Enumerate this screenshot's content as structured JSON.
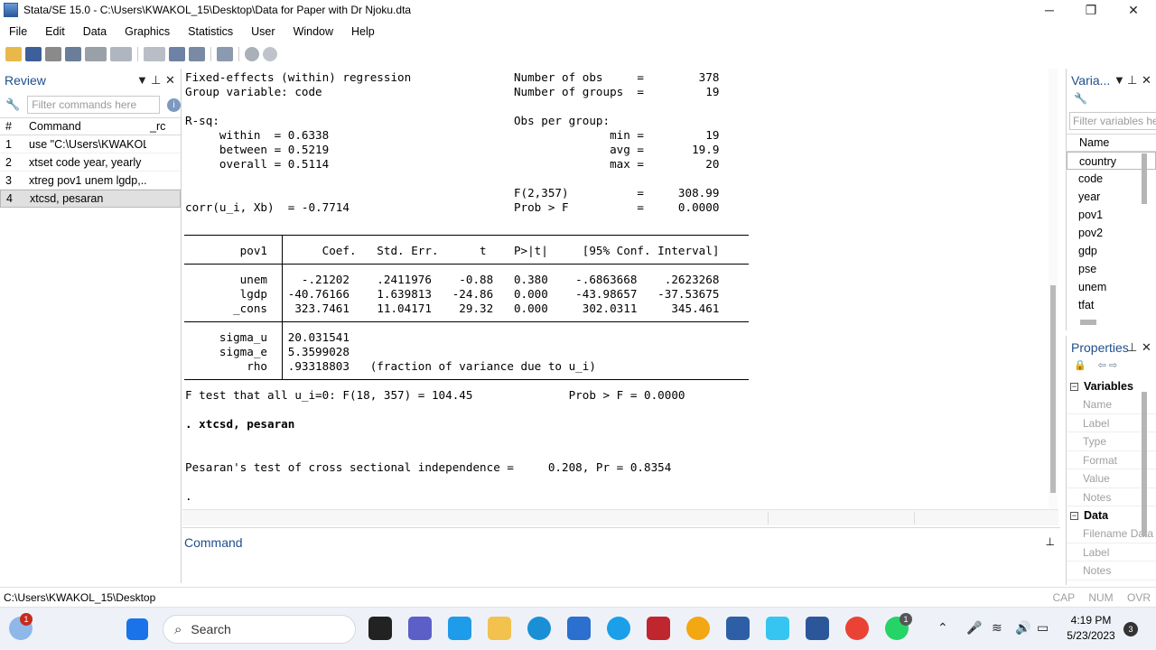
{
  "window": {
    "title": "Stata/SE 15.0 - C:\\Users\\KWAKOL_15\\Desktop\\Data for Paper with Dr Njoku.dta",
    "minimize": "─",
    "restore": "❐",
    "close": "✕"
  },
  "menu": [
    "File",
    "Edit",
    "Data",
    "Graphics",
    "Statistics",
    "User",
    "Window",
    "Help"
  ],
  "review": {
    "title": "Review",
    "filter_placeholder": "Filter commands here",
    "columns": {
      "num": "#",
      "command": "Command",
      "rc": "_rc"
    },
    "rows": [
      {
        "num": "1",
        "command": "use \"C:\\Users\\KWAKOL..."
      },
      {
        "num": "2",
        "command": "xtset code year, yearly"
      },
      {
        "num": "3",
        "command": "xtreg pov1 unem lgdp,..."
      },
      {
        "num": "4",
        "command": "xtcsd, pesaran"
      }
    ]
  },
  "results": {
    "lines": [
      "Fixed-effects (within) regression               Number of obs     =        378",
      "Group variable: code                            Number of groups  =         19",
      "",
      "R-sq:                                           Obs per group:",
      "     within  = 0.6338                                         min =         19",
      "     between = 0.5219                                         avg =       19.9",
      "     overall = 0.5114                                         max =         20",
      "",
      "                                                F(2,357)          =     308.99",
      "corr(u_i, Xb)  = -0.7714                        Prob > F          =     0.0000",
      "",
      "",
      "        pov1        Coef.   Std. Err.      t    P>|t|     [95% Conf. Interval]",
      "",
      "        unem     -.21202    .2411976    -0.88   0.380    -.6863668    .2623268",
      "        lgdp   -40.76166    1.639813   -24.86   0.000    -43.98657   -37.53675",
      "       _cons    323.7461    11.04171    29.32   0.000     302.0311     345.461",
      "",
      "     sigma_u   20.031541",
      "     sigma_e   5.3599028",
      "         rho   .93318803   (fraction of variance due to u_i)",
      "",
      "F test that all u_i=0: F(18, 357) = 104.45              Prob > F = 0.0000",
      "",
      ". xtcsd, pesaran",
      "",
      "",
      "Pesaran's test of cross sectional independence =     0.208, Pr = 0.8354",
      "",
      "."
    ]
  },
  "command_panel": {
    "label": "Command",
    "pin": "⊥"
  },
  "variables": {
    "title": "Varia...",
    "filter_placeholder": "Filter variables he",
    "column": "Name",
    "items": [
      "country",
      "code",
      "year",
      "pov1",
      "pov2",
      "gdp",
      "pse",
      "unem",
      "tfat"
    ]
  },
  "properties": {
    "title": "Properties",
    "groups": [
      {
        "name": "Variables",
        "rows": [
          "Name",
          "Label",
          "Type",
          "Format",
          "Value",
          "Notes"
        ]
      },
      {
        "name": "Data",
        "rows": [
          "Filename  Data",
          "Label",
          "Notes"
        ]
      }
    ]
  },
  "status": {
    "path": "C:\\Users\\KWAKOL_15\\Desktop",
    "cap": "CAP",
    "num": "NUM",
    "ovr": "OVR"
  },
  "taskbar": {
    "search_label": "Search",
    "time": "4:19 PM",
    "date": "5/23/2023",
    "notification_count": "3",
    "weather_badge": "1",
    "whatsapp_badge": "1"
  },
  "colors": {
    "accent": "#1f4e8c",
    "highlight": "#d8e4f4"
  }
}
